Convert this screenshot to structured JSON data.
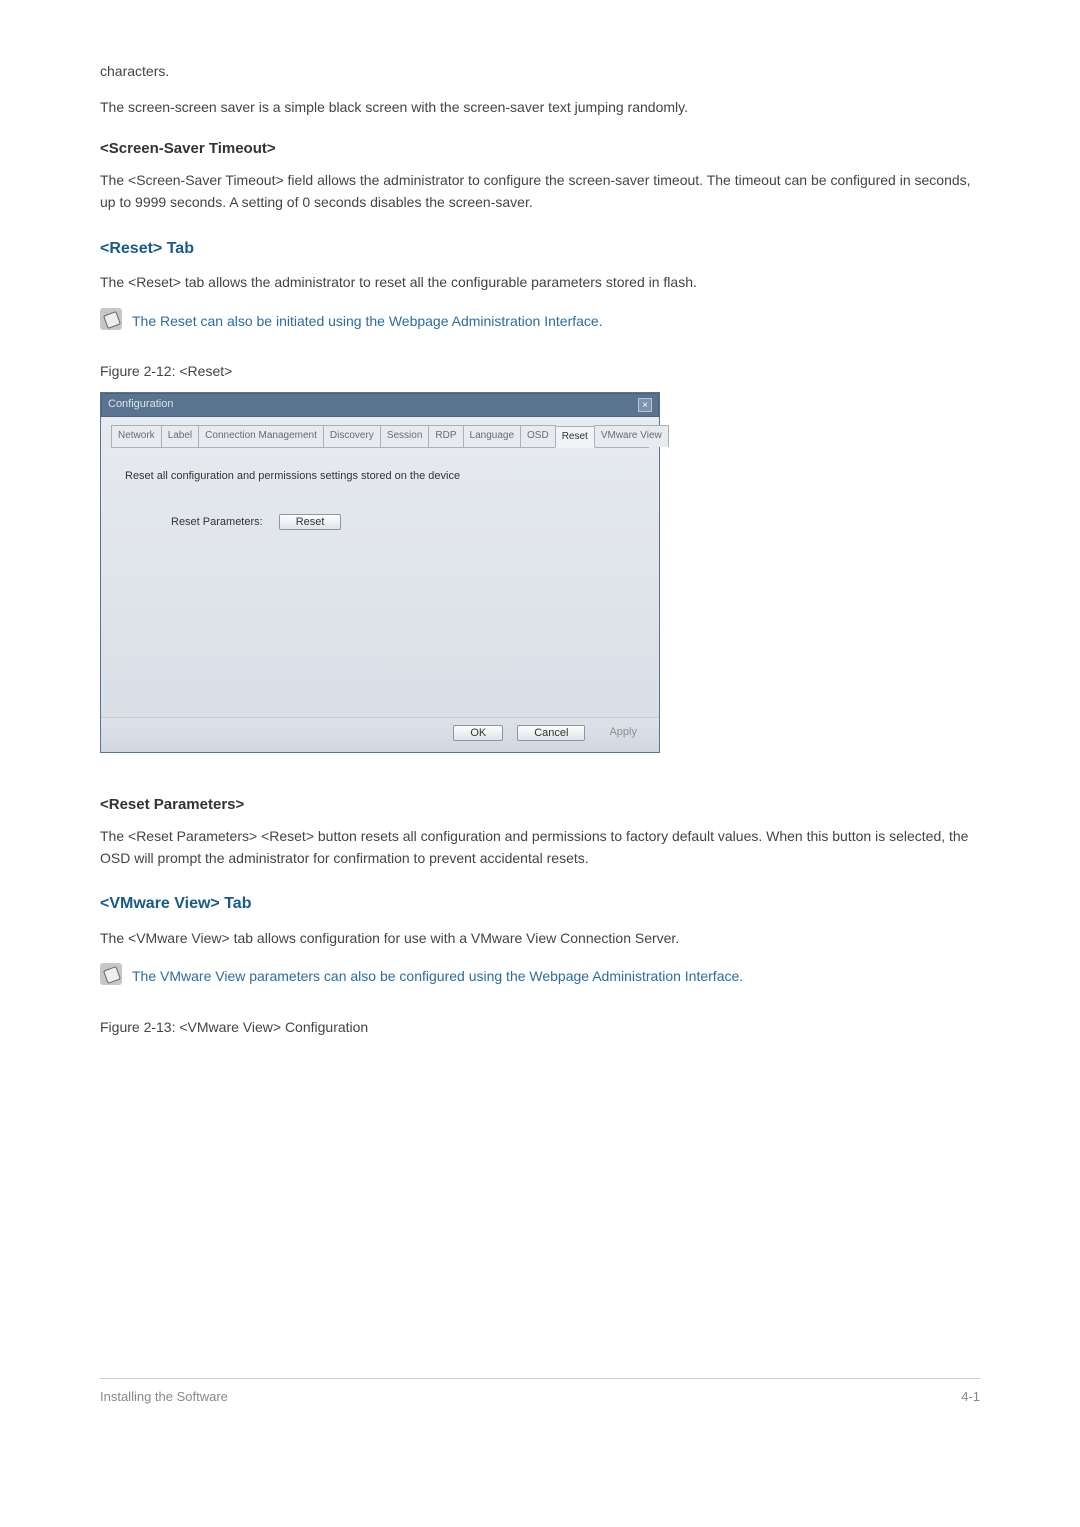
{
  "body": {
    "p_characters": "characters.",
    "p_screensaver_intro": "The screen-screen saver is a simple black screen with the screen-saver text jumping randomly.",
    "h_ss_timeout": "<Screen-Saver Timeout>",
    "p_ss_timeout": "The <Screen-Saver Timeout> field allows the administrator to configure the screen-saver timeout. The timeout can be configured in seconds, up to 9999 seconds. A setting of 0 seconds disables the screen-saver.",
    "h_reset_tab": "<Reset> Tab",
    "p_reset_tab": "The <Reset> tab allows the administrator to reset all the configurable parameters stored in flash.",
    "note_reset": "The Reset can also be initiated using the Webpage Administration Interface.",
    "fig_reset": "Figure 2-12: <Reset>",
    "h_reset_params": "<Reset Parameters>",
    "p_reset_params": "The <Reset Parameters> <Reset> button resets all configuration and permissions to factory default values. When this button is selected, the OSD will prompt the administrator for confirmation to prevent accidental resets.",
    "h_vmware_tab": "<VMware View> Tab",
    "p_vmware_tab": "The <VMware View> tab allows configuration for use with a VMware View Connection Server.",
    "note_vmware": "The VMware View parameters can also be configured using the Webpage Administration Interface.",
    "fig_vmware": "Figure 2-13: <VMware View> Configuration"
  },
  "dialog": {
    "title": "Configuration",
    "close": "×",
    "tabs": {
      "0": "Network",
      "1": "Label",
      "2": "Connection Management",
      "3": "Discovery",
      "4": "Session",
      "5": "RDP",
      "6": "Language",
      "7": "OSD",
      "8": "Reset",
      "9": "VMware View"
    },
    "content_text": "Reset all configuration and permissions settings stored on the device",
    "param_label": "Reset Parameters:",
    "reset_btn": "Reset",
    "ok": "OK",
    "cancel": "Cancel",
    "apply": "Apply"
  },
  "footer": {
    "left": "Installing the Software",
    "right": "4-1"
  }
}
